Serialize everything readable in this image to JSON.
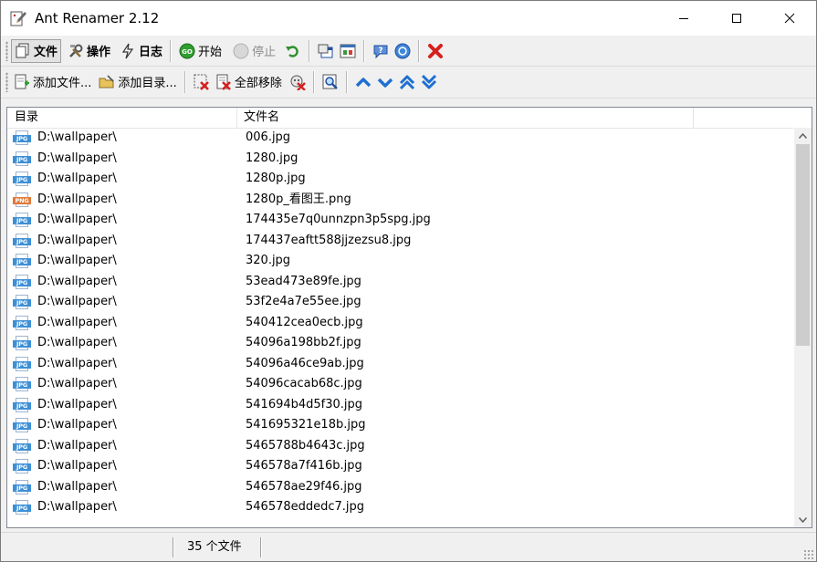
{
  "window": {
    "title": "Ant Renamer 2.12"
  },
  "toolbar_main": {
    "files_label": "文件",
    "actions_label": "操作",
    "log_label": "日志",
    "start_label": "开始",
    "stop_label": "停止"
  },
  "toolbar_files": {
    "add_files_label": "添加文件...",
    "add_folders_label": "添加目录...",
    "remove_all_label": "全部移除"
  },
  "list": {
    "columns": [
      "目录",
      "文件名"
    ],
    "rows": [
      {
        "dir": "D:\\wallpaper\\",
        "name": "006.jpg",
        "type": "JPG"
      },
      {
        "dir": "D:\\wallpaper\\",
        "name": "1280.jpg",
        "type": "JPG"
      },
      {
        "dir": "D:\\wallpaper\\",
        "name": "1280p.jpg",
        "type": "JPG"
      },
      {
        "dir": "D:\\wallpaper\\",
        "name": "1280p_看图王.png",
        "type": "PNG"
      },
      {
        "dir": "D:\\wallpaper\\",
        "name": "174435e7q0unnzpn3p5spg.jpg",
        "type": "JPG"
      },
      {
        "dir": "D:\\wallpaper\\",
        "name": "174437eaftt588jjzezsu8.jpg",
        "type": "JPG"
      },
      {
        "dir": "D:\\wallpaper\\",
        "name": "320.jpg",
        "type": "JPG"
      },
      {
        "dir": "D:\\wallpaper\\",
        "name": "53ead473e89fe.jpg",
        "type": "JPG"
      },
      {
        "dir": "D:\\wallpaper\\",
        "name": "53f2e4a7e55ee.jpg",
        "type": "JPG"
      },
      {
        "dir": "D:\\wallpaper\\",
        "name": "540412cea0ecb.jpg",
        "type": "JPG"
      },
      {
        "dir": "D:\\wallpaper\\",
        "name": "54096a198bb2f.jpg",
        "type": "JPG"
      },
      {
        "dir": "D:\\wallpaper\\",
        "name": "54096a46ce9ab.jpg",
        "type": "JPG"
      },
      {
        "dir": "D:\\wallpaper\\",
        "name": "54096cacab68c.jpg",
        "type": "JPG"
      },
      {
        "dir": "D:\\wallpaper\\",
        "name": "541694b4d5f30.jpg",
        "type": "JPG"
      },
      {
        "dir": "D:\\wallpaper\\",
        "name": "541695321e18b.jpg",
        "type": "JPG"
      },
      {
        "dir": "D:\\wallpaper\\",
        "name": "5465788b4643c.jpg",
        "type": "JPG"
      },
      {
        "dir": "D:\\wallpaper\\",
        "name": "546578a7f416b.jpg",
        "type": "JPG"
      },
      {
        "dir": "D:\\wallpaper\\",
        "name": "546578ae29f46.jpg",
        "type": "JPG"
      },
      {
        "dir": "D:\\wallpaper\\",
        "name": "546578eddedc7.jpg",
        "type": "JPG"
      }
    ]
  },
  "statusbar": {
    "file_count": "35 个文件"
  },
  "colors": {
    "accent_blue": "#1f6fd1",
    "go_green": "#2f9e2f",
    "close_red": "#d62020"
  }
}
